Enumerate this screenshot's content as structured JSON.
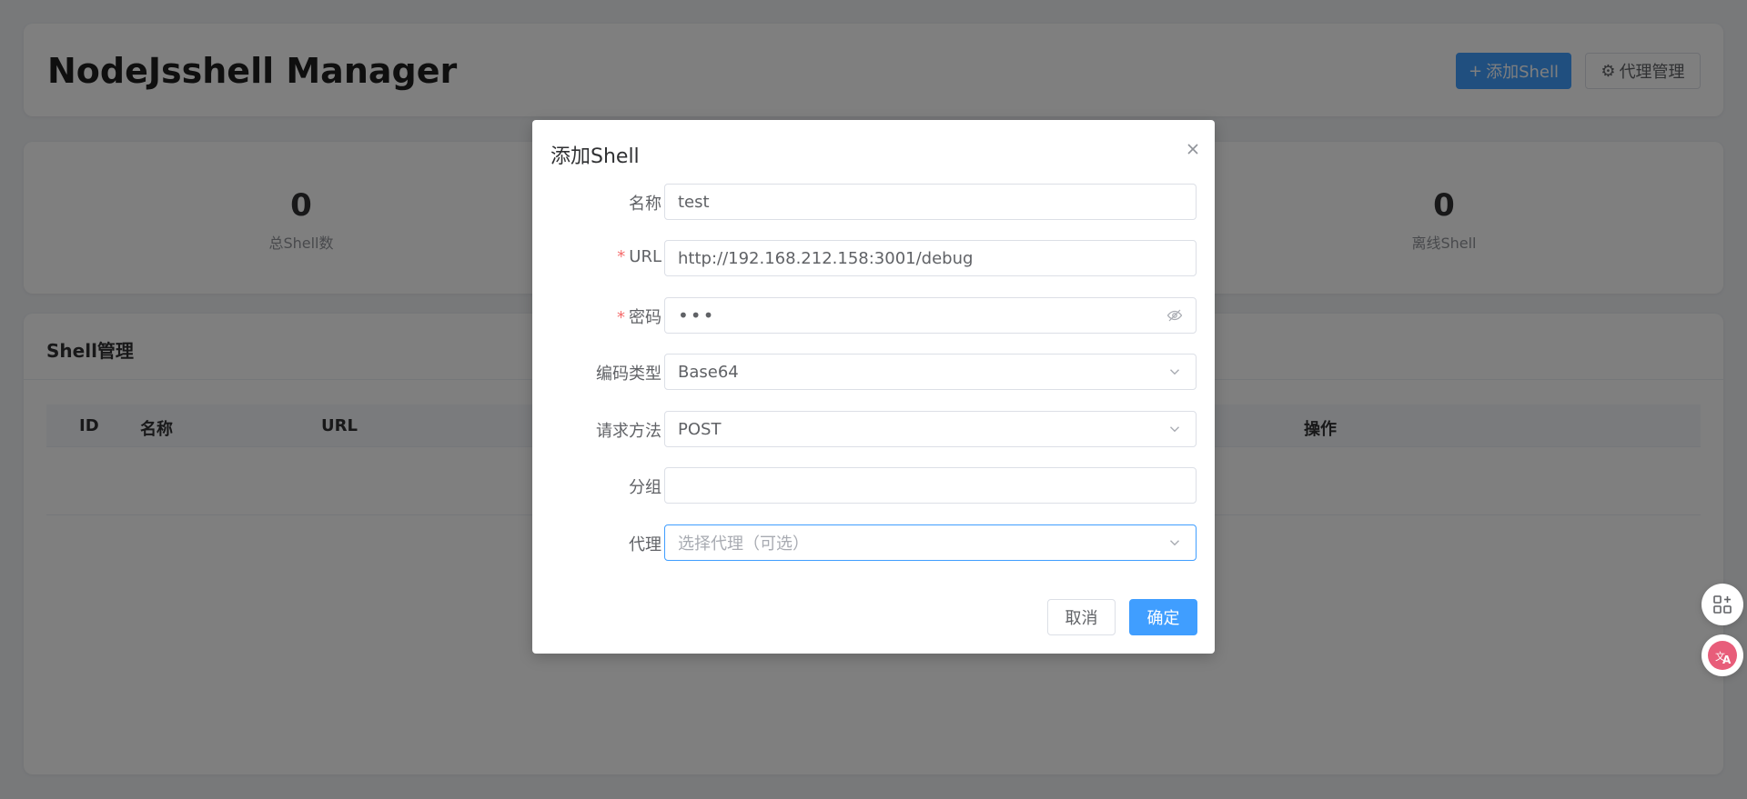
{
  "header": {
    "title": "NodeJsshell Manager",
    "add_shell_label": "添加Shell",
    "proxy_label": "代理管理"
  },
  "stats": {
    "total": {
      "value": "0",
      "label": "总Shell数"
    },
    "offline": {
      "value": "0",
      "label": "离线Shell"
    }
  },
  "table": {
    "title": "Shell管理",
    "columns": [
      "ID",
      "名称",
      "URL",
      "操作"
    ]
  },
  "dialog": {
    "title": "添加Shell",
    "fields": {
      "name": {
        "label": "名称",
        "value": "test"
      },
      "url": {
        "label": "URL",
        "value": "http://192.168.212.158:3001/debug"
      },
      "password": {
        "label": "密码",
        "value": "•••"
      },
      "encoding": {
        "label": "编码类型",
        "value": "Base64"
      },
      "method": {
        "label": "请求方法",
        "value": "POST"
      },
      "group": {
        "label": "分组",
        "value": ""
      },
      "proxy": {
        "label": "代理",
        "placeholder": "选择代理（可选）"
      }
    },
    "cancel_label": "取消",
    "confirm_label": "确定"
  },
  "colors": {
    "primary": "#409eff",
    "required": "#f56c6c",
    "overlay": "rgba(0,0,0,0.5)"
  }
}
